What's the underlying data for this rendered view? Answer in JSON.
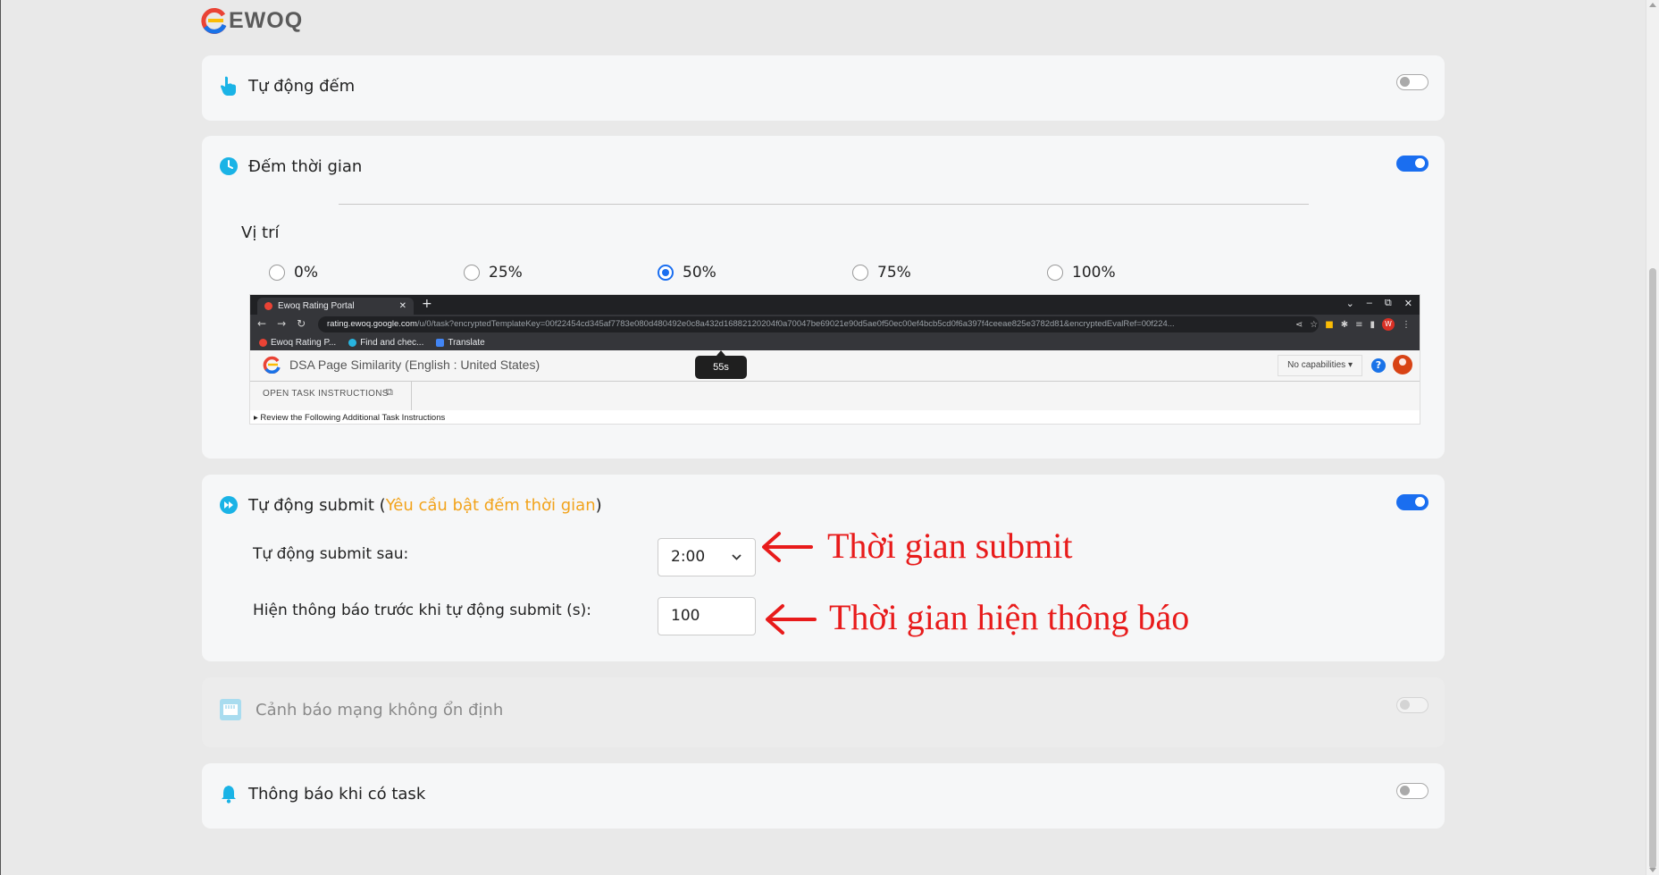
{
  "app": {
    "logo_text": "EWOQ",
    "logo_colors": [
      "#ea4335",
      "#1a73e8",
      "#fbbc05"
    ]
  },
  "cards": {
    "auto_count": {
      "label": "Tự động đếm",
      "icon": "hand-pointer-icon",
      "enabled": false
    },
    "timer": {
      "label": "Đếm thời gian",
      "icon": "clock-icon",
      "enabled": true,
      "position_label": "Vị trí",
      "positions": [
        "0%",
        "25%",
        "50%",
        "75%",
        "100%"
      ],
      "selected_position": "50%",
      "preview": {
        "tab_title": "Ewoq Rating Portal",
        "url_host": "rating.ewoq.google.com",
        "url_rest": "/u/0/task?encryptedTemplateKey=00f22454cd345af7783e080d480492e0c8a432d16882120204f0a70047be69021e90d5ae0f50ec00ef4bcb5cd0f6a397f4ceeae825e3782d81&encryptedEvalRef=00f224...",
        "bookmarks": [
          "Ewoq Rating P...",
          "Find and chec...",
          "Translate"
        ],
        "page_title": "DSA Page Similarity (English : United States)",
        "timer_text": "55s",
        "capabilities": "No capabilities",
        "instructions_btn": "OPEN TASK INSTRUCTIONS",
        "review_text": "Review the Following Additional Task Instructions"
      }
    },
    "auto_submit": {
      "label": "Tự động submit",
      "paren_open": " (",
      "warning": "Yêu cầu bật đếm thời gian",
      "paren_close": ")",
      "icon": "fast-forward-icon",
      "enabled": true,
      "submit_after_label": "Tự động submit sau:",
      "submit_after_value": "2:00",
      "notify_before_label": "Hiện thông báo trước khi tự động submit (s):",
      "notify_before_value": "100"
    },
    "network_warning": {
      "label": "Cảnh báo mạng không ổn định",
      "icon": "ethernet-icon",
      "enabled": false,
      "disabled": true
    },
    "task_notify": {
      "label": "Thông báo khi có task",
      "icon": "bell-icon",
      "enabled": false
    }
  },
  "annotations": {
    "submit_time": "Thời gian submit",
    "notify_time": "Thời gian hiện thông báo",
    "color": "#e81b1b"
  },
  "colors": {
    "accent": "#1a6ef0",
    "icon": "#1ab3e6",
    "warning": "#f2a31b",
    "background": "#e9e9e9",
    "card": "#f6f7f8"
  }
}
